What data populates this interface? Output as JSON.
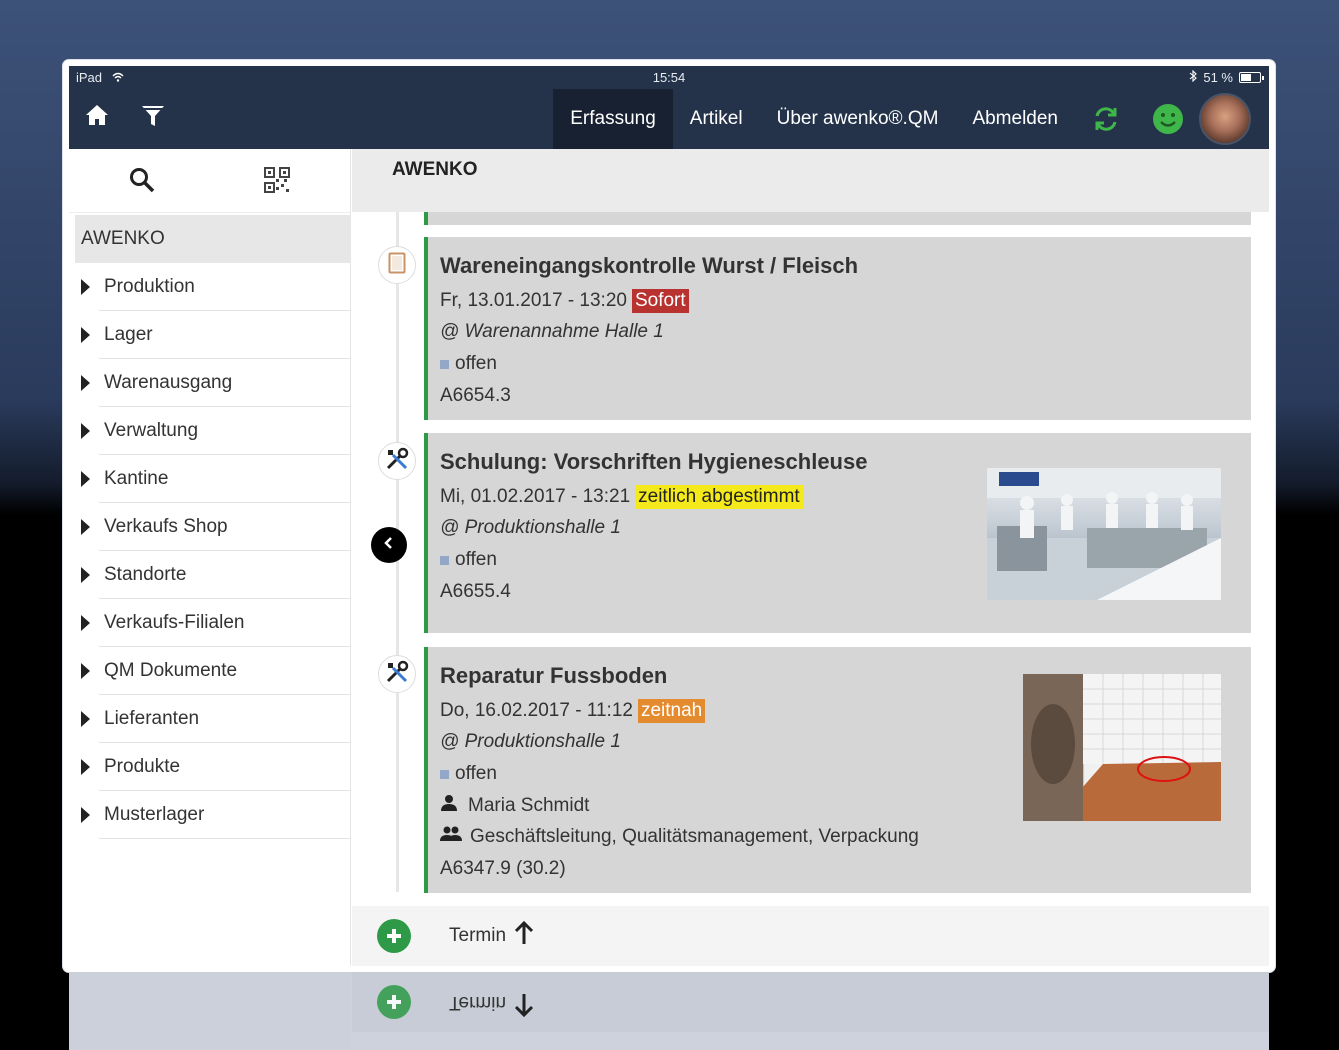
{
  "status": {
    "device": "iPad",
    "time": "15:54",
    "battery": "51 %"
  },
  "nav": {
    "items": [
      "Erfassung",
      "Artikel",
      "Über awenko®.QM",
      "Abmelden"
    ],
    "active": 0
  },
  "sidebar": {
    "root": "AWENKO",
    "items": [
      "Produktion",
      "Lager",
      "Warenausgang",
      "Verwaltung",
      "Kantine",
      "Verkaufs Shop",
      "Standorte",
      "Verkaufs-Filialen",
      "QM Dokumente",
      "Lieferanten",
      "Produkte",
      "Musterlager"
    ]
  },
  "header": {
    "title": "AWENKO"
  },
  "cards": [
    {
      "title": "Wareneingangskontrolle Wurst / Fleisch",
      "date": "Fr, 13.01.2017 - 13:20",
      "tag": "Sofort",
      "tag_color": "#b8322f",
      "location": "@ Warenannahme Halle 1",
      "status": "offen",
      "code": "A6654.3",
      "icon": "document-icon"
    },
    {
      "title": "Schulung: Vorschriften Hygieneschleuse",
      "date": "Mi, 01.02.2017 - 13:21",
      "tag": "zeitlich abgestimmt",
      "tag_color": "#f4ea1b",
      "location": "@ Produktionshalle 1",
      "status": "offen",
      "code": "A6655.4",
      "icon": "tools-icon"
    },
    {
      "title": "Reparatur Fussboden",
      "date": "Do, 16.02.2017 - 11:12",
      "tag": "zeitnah",
      "tag_color": "#e58b2f",
      "location": "@ Produktionshalle 1",
      "status": "offen",
      "person": "Maria Schmidt",
      "groups": "Geschäftsleitung, Qualitätsmanagement, Verpackung",
      "code": "A6347.9 (30.2)",
      "icon": "tools-icon"
    }
  ],
  "footer": {
    "label": "Termin"
  }
}
